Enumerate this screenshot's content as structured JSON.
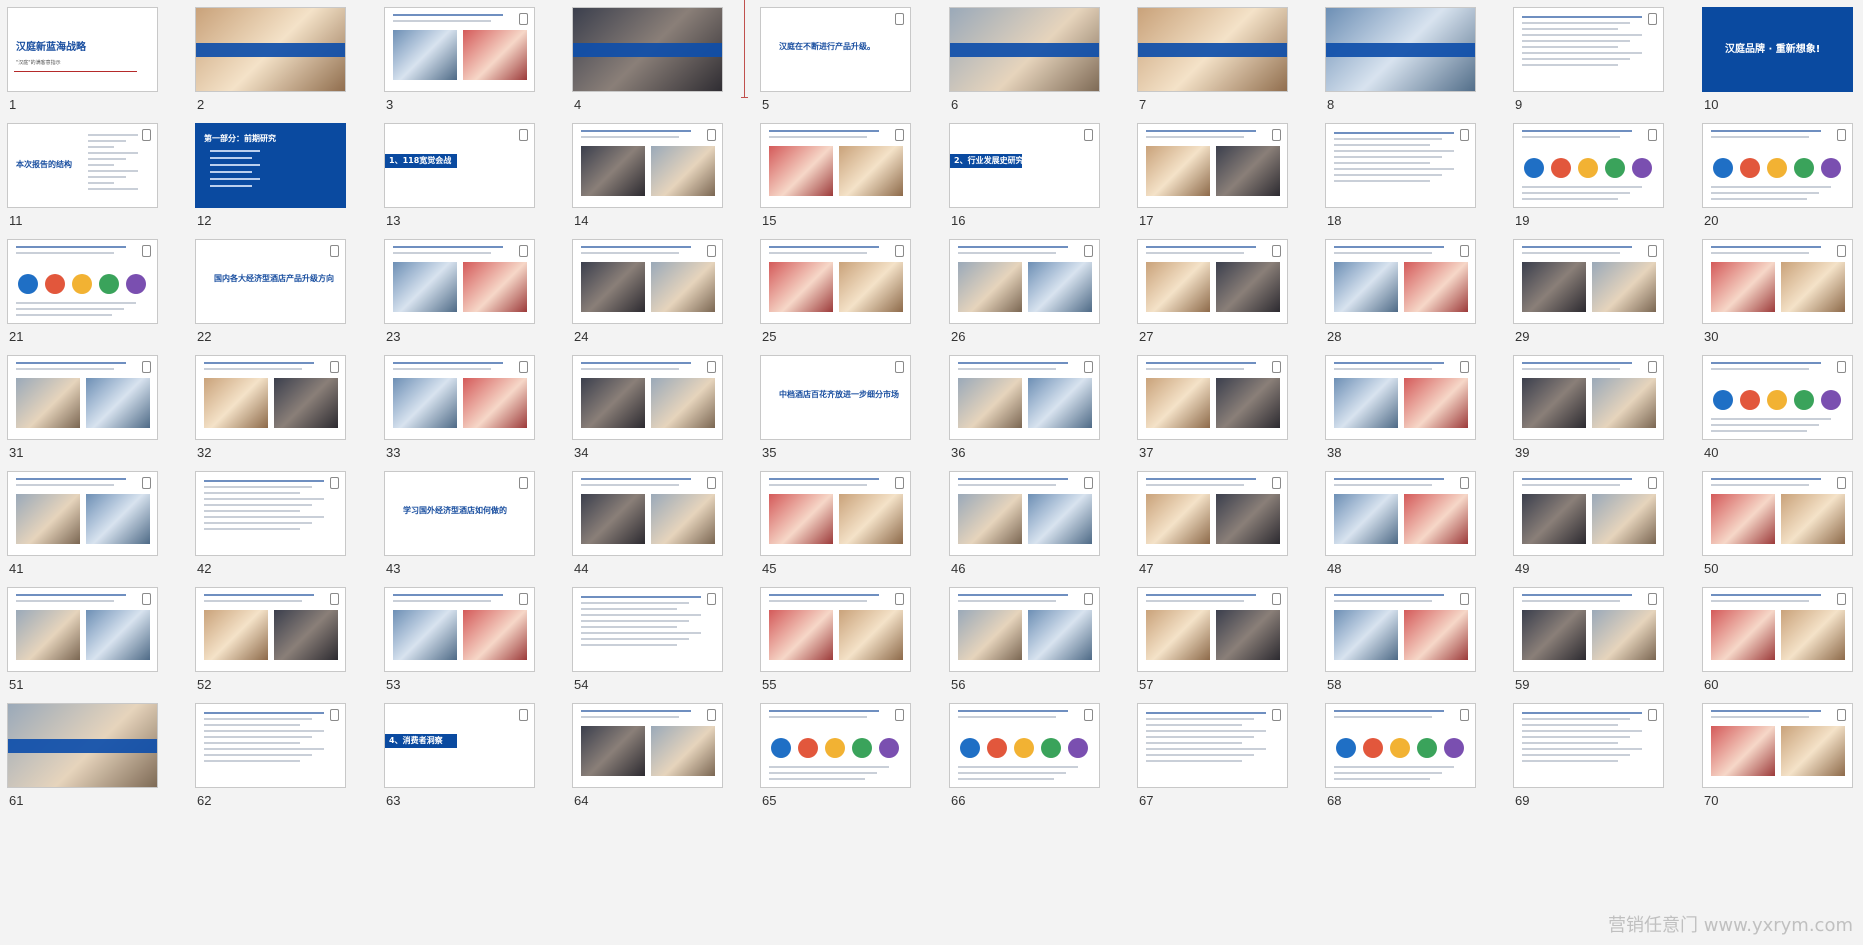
{
  "watermark": "营销任意门 www.yxrym.com",
  "colors": {
    "brand_blue": "#0a4aa0",
    "title_blue": "#1a4fa0",
    "divider_red": "#b52a2a",
    "insert_marker": "#c0504d"
  },
  "slides": [
    {
      "num": "1",
      "style": "title",
      "title": "汉庭新蓝海战略",
      "subtitle": "\"汉庭\"的满客意指示"
    },
    {
      "num": "2",
      "style": "photo"
    },
    {
      "num": "3",
      "style": "photo-white"
    },
    {
      "num": "4",
      "style": "photo"
    },
    {
      "num": "5",
      "style": "text",
      "title": "汉庭在不断进行产品升级。"
    },
    {
      "num": "6",
      "style": "photo"
    },
    {
      "num": "7",
      "style": "photo"
    },
    {
      "num": "8",
      "style": "photo"
    },
    {
      "num": "9",
      "style": "text-list"
    },
    {
      "num": "10",
      "style": "blue",
      "title": "汉庭品牌 · 重新想象!"
    },
    {
      "num": "11",
      "style": "agenda",
      "title": "本次报告的结构"
    },
    {
      "num": "12",
      "style": "blue-list",
      "title": "第一部分：前期研究"
    },
    {
      "num": "13",
      "style": "section",
      "title": "1、118宽觉会战"
    },
    {
      "num": "14",
      "style": "photo-white"
    },
    {
      "num": "15",
      "style": "photo-white"
    },
    {
      "num": "16",
      "style": "section",
      "title": "2、行业发展史研究"
    },
    {
      "num": "17",
      "style": "photo-white"
    },
    {
      "num": "18",
      "style": "text-list"
    },
    {
      "num": "19",
      "style": "diagram"
    },
    {
      "num": "20",
      "style": "diagram"
    },
    {
      "num": "21",
      "style": "diagram"
    },
    {
      "num": "22",
      "style": "text",
      "title": "国内各大经济型酒店产品升级方向"
    },
    {
      "num": "23",
      "style": "photo-white"
    },
    {
      "num": "24",
      "style": "photo-white"
    },
    {
      "num": "25",
      "style": "photo-white"
    },
    {
      "num": "26",
      "style": "photo-white"
    },
    {
      "num": "27",
      "style": "photo-white"
    },
    {
      "num": "28",
      "style": "photo-white"
    },
    {
      "num": "29",
      "style": "photo-white"
    },
    {
      "num": "30",
      "style": "photo-white"
    },
    {
      "num": "31",
      "style": "photo-white"
    },
    {
      "num": "32",
      "style": "photo-white"
    },
    {
      "num": "33",
      "style": "photo-white"
    },
    {
      "num": "34",
      "style": "photo-white"
    },
    {
      "num": "35",
      "style": "text",
      "title": "中档酒店百花齐放进一步细分市场"
    },
    {
      "num": "36",
      "style": "photo-white"
    },
    {
      "num": "37",
      "style": "photo-white"
    },
    {
      "num": "38",
      "style": "photo-white"
    },
    {
      "num": "39",
      "style": "photo-white"
    },
    {
      "num": "40",
      "style": "diagram"
    },
    {
      "num": "41",
      "style": "photo-white"
    },
    {
      "num": "42",
      "style": "text-list"
    },
    {
      "num": "43",
      "style": "text",
      "title": "学习国外经济型酒店如何做的"
    },
    {
      "num": "44",
      "style": "photo-white"
    },
    {
      "num": "45",
      "style": "photo-white"
    },
    {
      "num": "46",
      "style": "photo-white"
    },
    {
      "num": "47",
      "style": "photo-white"
    },
    {
      "num": "48",
      "style": "photo-white"
    },
    {
      "num": "49",
      "style": "photo-white"
    },
    {
      "num": "50",
      "style": "photo-white"
    },
    {
      "num": "51",
      "style": "photo-white"
    },
    {
      "num": "52",
      "style": "photo-white"
    },
    {
      "num": "53",
      "style": "photo-white"
    },
    {
      "num": "54",
      "style": "text-list"
    },
    {
      "num": "55",
      "style": "photo-white"
    },
    {
      "num": "56",
      "style": "photo-white"
    },
    {
      "num": "57",
      "style": "photo-white"
    },
    {
      "num": "58",
      "style": "photo-white"
    },
    {
      "num": "59",
      "style": "photo-white"
    },
    {
      "num": "60",
      "style": "photo-white"
    },
    {
      "num": "61",
      "style": "photo"
    },
    {
      "num": "62",
      "style": "text-list"
    },
    {
      "num": "63",
      "style": "section",
      "title": "4、消费者洞察"
    },
    {
      "num": "64",
      "style": "photo-white"
    },
    {
      "num": "65",
      "style": "diagram"
    },
    {
      "num": "66",
      "style": "diagram"
    },
    {
      "num": "67",
      "style": "text-list"
    },
    {
      "num": "68",
      "style": "diagram"
    },
    {
      "num": "69",
      "style": "text-list"
    },
    {
      "num": "70",
      "style": "photo-white"
    }
  ]
}
